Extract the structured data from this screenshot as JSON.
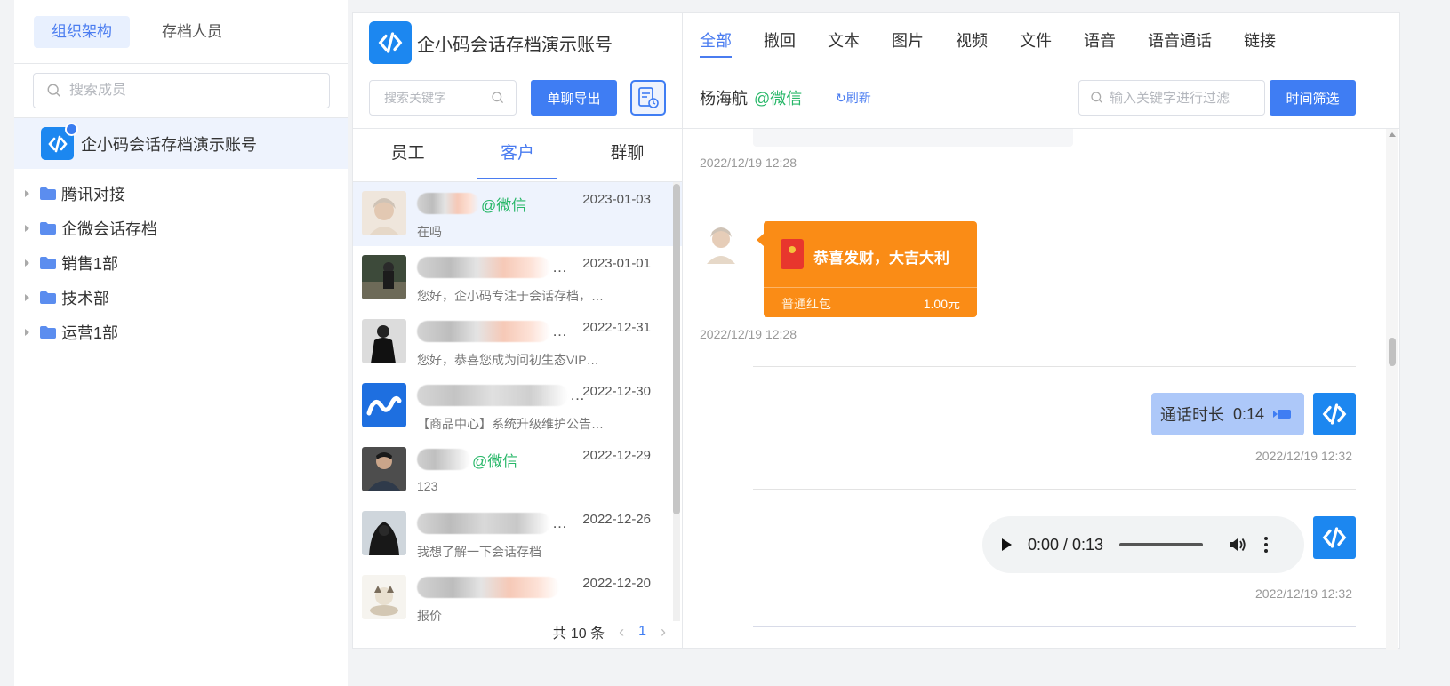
{
  "org_panel": {
    "tabs": [
      {
        "label": "组织架构",
        "active": true
      },
      {
        "label": "存档人员",
        "active": false
      }
    ],
    "search_placeholder": "搜索成员",
    "account_name": "企小码会话存档演示账号",
    "tree": [
      {
        "label": "腾讯对接"
      },
      {
        "label": "企微会话存档"
      },
      {
        "label": "销售1部"
      },
      {
        "label": "技术部"
      },
      {
        "label": "运营1部"
      }
    ]
  },
  "middle_panel": {
    "account_title": "企小码会话存档演示账号",
    "keyword_placeholder": "搜索关键字",
    "export_label": "单聊导出",
    "category_tabs": [
      {
        "label": "员工",
        "active": false
      },
      {
        "label": "客户",
        "active": true
      },
      {
        "label": "群聊",
        "active": false
      }
    ],
    "conversations": [
      {
        "tag": "@微信",
        "date": "2023-01-03",
        "preview": "在吗",
        "active": true
      },
      {
        "tag": "",
        "date": "2023-01-01",
        "preview": "您好，企小码专注于会话存档，…",
        "active": false
      },
      {
        "tag": "",
        "date": "2022-12-31",
        "preview": "您好，恭喜您成为问初生态VIP…",
        "active": false
      },
      {
        "tag": "",
        "date": "2022-12-30",
        "preview": "【商品中心】系统升级维护公告…",
        "active": false
      },
      {
        "tag": "@微信",
        "date": "2022-12-29",
        "preview": "123",
        "active": false
      },
      {
        "tag": "",
        "date": "2022-12-26",
        "preview": "我想了解一下会话存档",
        "active": false
      },
      {
        "tag": "",
        "date": "2022-12-20",
        "preview": "报价",
        "active": false
      }
    ],
    "pager": {
      "total": "共 10 条",
      "page": "1"
    }
  },
  "chat_panel": {
    "type_tabs": [
      {
        "label": "全部",
        "active": true
      },
      {
        "label": "撤回"
      },
      {
        "label": "文本"
      },
      {
        "label": "图片"
      },
      {
        "label": "视频"
      },
      {
        "label": "文件"
      },
      {
        "label": "语音"
      },
      {
        "label": "语音通话"
      },
      {
        "label": "链接"
      }
    ],
    "peer_name": "杨海航",
    "peer_tag": "@微信",
    "refresh_label": "刷新",
    "filter_placeholder": "输入关键字进行过滤",
    "time_filter_label": "时间筛选",
    "messages": {
      "ts1": "2022/12/19 12:28",
      "red_packet": {
        "title": "恭喜发财，大吉大利",
        "type": "普通红包",
        "amount": "1.00元"
      },
      "ts2": "2022/12/19 12:28",
      "call": {
        "label": "通话时长",
        "duration": "0:14"
      },
      "ts3": "2022/12/19 12:32",
      "audio": {
        "time": "0:00 / 0:13"
      },
      "ts4": "2022/12/19 12:32"
    }
  },
  "colors": {
    "accent": "#3f7df3",
    "wechat_green": "#27b768",
    "red_packet": "#fa8c16"
  }
}
